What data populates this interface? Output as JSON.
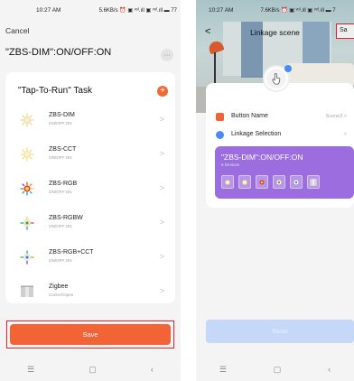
{
  "left": {
    "status": {
      "time": "10:27 AM",
      "info": "5.6KB/s ⏰ ▣ ᵛᵒˡ.ıll ▣ ᵛᵒˡ.ıll ▬ 77"
    },
    "cancel_label": "Cancel",
    "scene_title": "\"ZBS-DIM\":ON/OFF:ON",
    "more_label": "···",
    "task_title": "\"Tap-To-Run\" Task",
    "add_label": "+",
    "tasks": [
      {
        "name": "ZBS-DIM",
        "sub": "ON/OFF:ON",
        "icon": "dim-bulb-icon"
      },
      {
        "name": "ZBS-CCT",
        "sub": "ON/OFF:ON",
        "icon": "cct-bulb-icon"
      },
      {
        "name": "ZBS-RGB",
        "sub": "ON/OFF:ON",
        "icon": "rgb-bulb-icon"
      },
      {
        "name": "ZBS-RGBW",
        "sub": "ON/OFF:ON",
        "icon": "rgbw-bulb-icon"
      },
      {
        "name": "ZBS-RGB+CCT",
        "sub": "ON/OFF:ON",
        "icon": "rgbcct-bulb-icon"
      },
      {
        "name": "Zigbee",
        "sub": "Control:Open",
        "icon": "curtain-icon"
      }
    ],
    "chevron": ">",
    "save_label": "Save",
    "nav": {
      "menu": "☰",
      "home": "▢",
      "back": "‹"
    }
  },
  "right": {
    "status": {
      "time": "10:27 AM",
      "info": "7.6KB/s ⏰ ▣ ᵛᵒˡ.ıll ▣ ᵛᵒˡ.ıll ▬ 7"
    },
    "back_label": "<",
    "title": "Linkage scene",
    "save_top_label": "Sa",
    "button_name_label": "Button Name",
    "button_name_value": "Scene2 >",
    "linkage_label": "Linkage Selection",
    "linkage_chev": ">",
    "scene_name": "\"ZBS-DIM\":ON/OFF:ON",
    "devices_count": "6 Devices",
    "reset_label": "Reset",
    "nav": {
      "menu": "☰",
      "home": "▢",
      "back": "‹"
    }
  },
  "colors": {
    "accent": "#f26436",
    "highlight": "#e0202a",
    "purple": "#9c6dde",
    "blue": "#4b8bf5"
  }
}
